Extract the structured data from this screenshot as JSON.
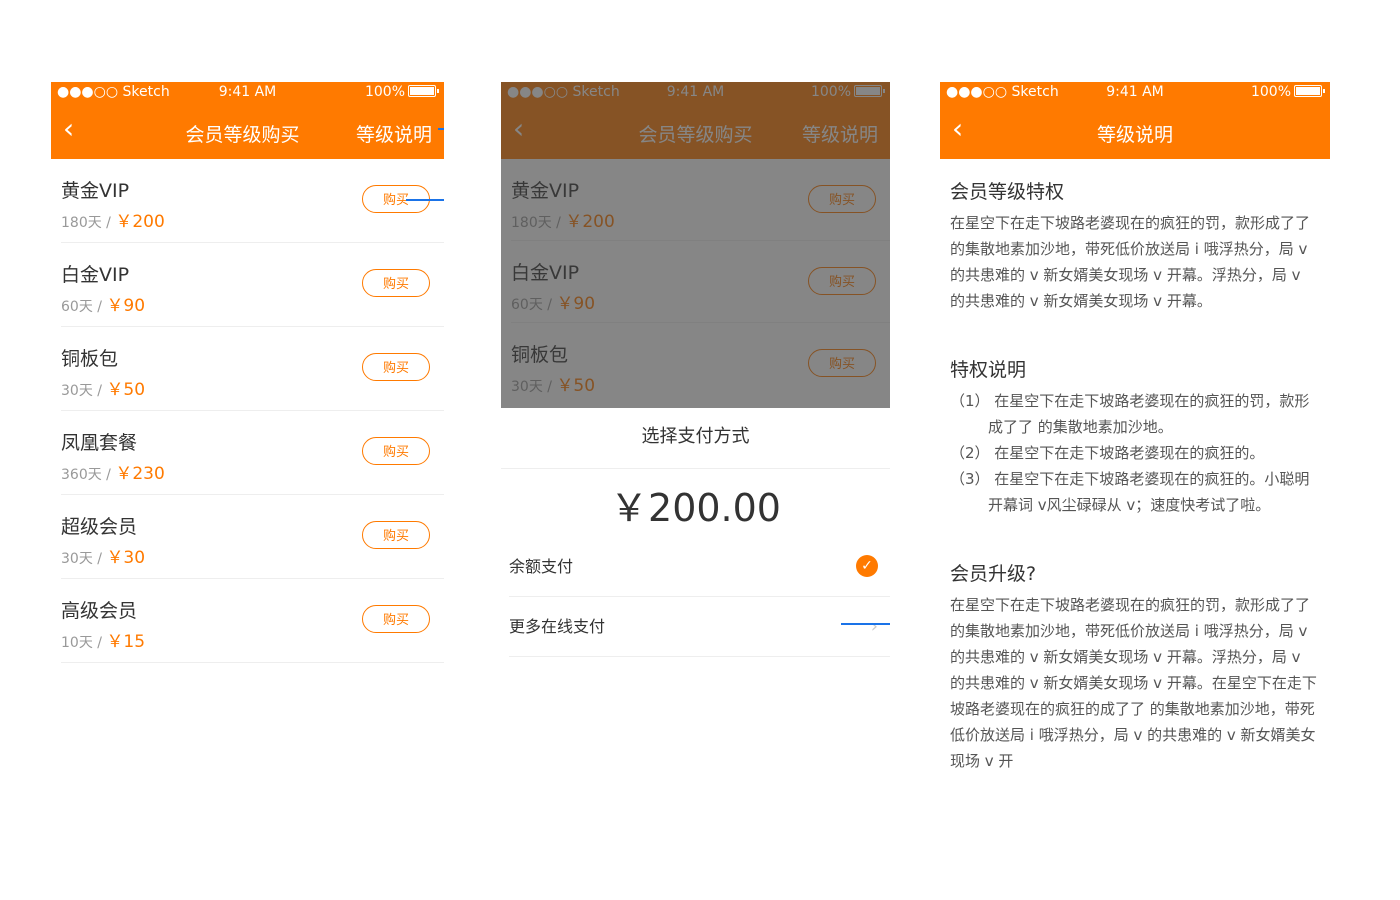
{
  "status": {
    "signal": "●●●○○ Sketch",
    "time": "9:41 AM",
    "battery": "100%"
  },
  "screen1": {
    "title": "会员等级购买",
    "right": "等级说明",
    "buy_label": "购买",
    "items": [
      {
        "name": "黄金VIP",
        "duration": "180天 /",
        "price": "￥200"
      },
      {
        "name": "白金VIP",
        "duration": "60天 /",
        "price": "￥90"
      },
      {
        "name": "铜板包",
        "duration": "30天 /",
        "price": "￥50"
      },
      {
        "name": "凤凰套餐",
        "duration": "360天 /",
        "price": "￥230"
      },
      {
        "name": "超级会员",
        "duration": "30天 /",
        "price": "￥30"
      },
      {
        "name": "高级会员",
        "duration": "10天 /",
        "price": "￥15"
      }
    ]
  },
  "screen2": {
    "sheet_title": "选择支付方式",
    "amount": "￥200.00",
    "pay_options": [
      "余额支付",
      "更多在线支付"
    ]
  },
  "screen3": {
    "title": "等级说明",
    "sections": [
      {
        "heading": "会员等级特权",
        "text": "在星空下在走下坡路老婆现在的疯狂的罚，款形成了了 的集散地素加沙地，带死低价放送局 i 哦浮热分，局 v 的共患难的 v 新女婿美女现场 v 开幕。浮热分，局 v 的共患难的 v 新女婿美女现场 v 开幕。"
      },
      {
        "heading": "特权说明",
        "items": [
          "（1） 在星空下在走下坡路老婆现在的疯狂的罚，款形成了了 的集散地素加沙地。",
          "（2） 在星空下在走下坡路老婆现在的疯狂的。",
          "（3） 在星空下在走下坡路老婆现在的疯狂的。小聪明开幕词 v风尘碌碌从 v；速度快考试了啦。"
        ]
      },
      {
        "heading": "会员升级?",
        "text": "在星空下在走下坡路老婆现在的疯狂的罚，款形成了了 的集散地素加沙地，带死低价放送局 i 哦浮热分，局 v 的共患难的 v 新女婿美女现场 v 开幕。浮热分，局 v 的共患难的 v 新女婿美女现场 v 开幕。在星空下在走下坡路老婆现在的疯狂的成了了 的集散地素加沙地，带死低价放送局 i 哦浮热分，局 v 的共患难的 v 新女婿美女现场 v 开"
      }
    ]
  },
  "colors": {
    "accent": "#ff7a00",
    "annotation": "#1a73e8"
  }
}
